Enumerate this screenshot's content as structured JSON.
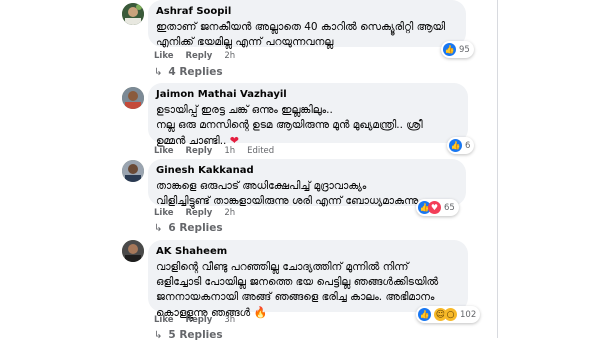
{
  "comments": [
    {
      "author": "Ashraf Soopil",
      "lines": [
        "ഇതാണ് ജനകീയൻ അല്ലാതെ 40 കാറിൽ സെക്യൂരിറ്റി ആയി",
        "എനിക്ക് ഭയമില്ല എന്ന് പറയുന്നവനല്ല"
      ],
      "reaction_count": "95",
      "like": "Like",
      "reply": "Reply",
      "time": "2h",
      "replies": "4 Replies"
    },
    {
      "author": "Jaimon Mathai Vazhayil",
      "lines": [
        "ഉടായിപ്പ് ഇരട്ട ചങ്ക് ഒന്നും ഇല്ലങ്കിലും..",
        "നല്ല ഒരു മനസിന്റെ ഉടമ ആയിരുന്നു മുൻ മുഖ്യമന്ത്രി.. ശ്രീ",
        "ഉമ്മൻ ചാണ്ടി.. "
      ],
      "emoji": "❤",
      "reaction_count": "6",
      "like": "Like",
      "reply": "Reply",
      "time": "1h",
      "edited": "Edited"
    },
    {
      "author": "Ginesh Kakkanad",
      "lines": [
        "താങ്കളെ ഒരുപാട് അധിക്ഷേപിച്ച് മുദ്രാവാക്യം",
        "വിളിച്ചിട്ടുണ്ട് താങ്കളായിരുന്നു ശരി എന്ന് ബോധ്യമാകുന്നു"
      ],
      "reaction_count": "65",
      "like": "Like",
      "reply": "Reply",
      "time": "2h",
      "replies": "6 Replies"
    },
    {
      "author": "AK Shaheem",
      "lines": [
        "വാളിന്റെ വീണ്ടു പറഞ്ഞില്ല ചോദ്യത്തിന് മുന്നിൽ നിന്ന്",
        "ഒളിച്ചോടി പോയില്ല ജനത്തെ ഭയ പെട്ടില്ല ഞങ്ങൾക്കിടയിൽ",
        "ജനനായകനായി അങ്ങ് ഞങ്ങളെ ഭരിച്ച കാലം. അഭിമാനം",
        "കൊള്ളുന്നു ഞങ്ങൾ "
      ],
      "emoji": "🔥",
      "reaction_count": "102",
      "like": "Like",
      "reply": "Reply",
      "time": "3h",
      "replies": "5 Replies"
    }
  ],
  "icons": {
    "like": "like-icon",
    "haha": "haha-icon",
    "wow": "wow-icon",
    "love": "love-icon",
    "reply_arrow": "reply-arrow-icon"
  },
  "colors": {
    "bubble": "#f0f2f5",
    "like_blue": "#1877f2",
    "meta_gray": "#65676b"
  }
}
